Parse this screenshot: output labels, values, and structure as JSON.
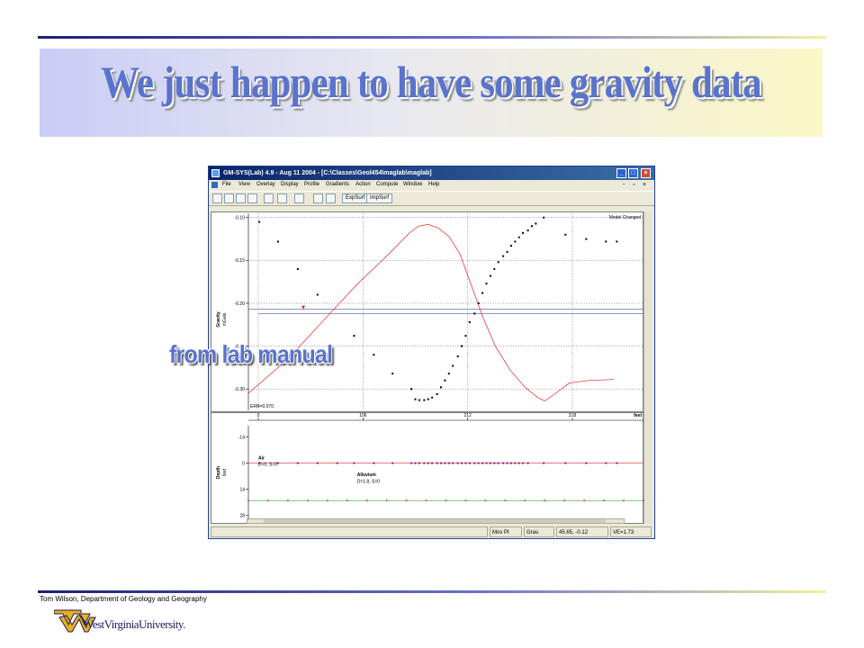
{
  "slide": {
    "title": "We just happen to have some gravity data",
    "annotation": "from lab manual",
    "author": "Tom Wilson, Department of Geology and Geography",
    "university": "WestVirginiaUniversity."
  },
  "colors": {
    "title": "#5a73cc",
    "rule_dark": "#1a1f7a",
    "rule_light": "#f3f0a0",
    "calc_curve": "#e02020",
    "observed_points": "#000000",
    "regional_line": "#6070c0",
    "air_line": "#e05050",
    "alluvium_line": "#30a030"
  },
  "window": {
    "title": "GM-SYS(Lab) 4.9 - Aug 11 2004 - [C:\\Classes\\Geol454\\maglab\\maglab]",
    "menu": [
      "File",
      "View",
      "Overlay",
      "Display",
      "Profile",
      "Gradients",
      "Action",
      "Compute",
      "Window",
      "Help"
    ],
    "toolbar_buttons": [
      "ExpSurf",
      "ImpSurf"
    ],
    "controls": {
      "minimize": "_",
      "maximize": "□",
      "close": "×",
      "menu_min": "-",
      "menu_max": "▫",
      "menu_close": "×"
    },
    "status": {
      "mode": "Mov Pt",
      "field": "Grav.",
      "coords": "45.65, -0.12",
      "ve": "VE=1.73"
    }
  },
  "chart_data": [
    {
      "type": "scatter",
      "title": "",
      "ylabel": "Gravity\nmGals",
      "xlabel": "",
      "xlim": [
        -10,
        390
      ],
      "ylim": [
        -0.325,
        -0.095
      ],
      "y_ticks": [
        -0.1,
        -0.15,
        -0.2,
        -0.25,
        -0.3
      ],
      "y_tick_labels": [
        "-0.10",
        "-0.15",
        "-0.20",
        "-0.25",
        "-0.30"
      ],
      "x_ticks": [
        0,
        106,
        212,
        318
      ],
      "corner_label": "Model Changed",
      "error_label": "ERR=0.070",
      "observed": {
        "x": [
          1,
          20,
          40,
          60,
          97,
          117,
          136,
          155,
          159,
          163,
          168,
          172,
          176,
          181,
          185,
          189,
          193,
          197,
          202,
          206,
          210,
          214,
          219,
          223,
          227,
          231,
          235,
          239,
          243,
          248,
          252,
          256,
          260,
          264,
          268,
          273,
          277,
          281,
          289,
          311,
          332,
          352,
          363
        ],
        "y": [
          -0.105,
          -0.128,
          -0.16,
          -0.19,
          -0.238,
          -0.26,
          -0.282,
          -0.3,
          -0.312,
          -0.313,
          -0.313,
          -0.312,
          -0.31,
          -0.306,
          -0.298,
          -0.29,
          -0.282,
          -0.273,
          -0.262,
          -0.25,
          -0.238,
          -0.222,
          -0.212,
          -0.2,
          -0.188,
          -0.177,
          -0.168,
          -0.16,
          -0.152,
          -0.145,
          -0.14,
          -0.133,
          -0.128,
          -0.123,
          -0.118,
          -0.115,
          -0.11,
          -0.107,
          -0.1,
          -0.12,
          -0.125,
          -0.128,
          -0.128
        ]
      },
      "calculated": {
        "x": [
          -10,
          30,
          70,
          100,
          130,
          153,
          162,
          172,
          182,
          193,
          204,
          216,
          228,
          240,
          255,
          270,
          283,
          290,
          300,
          315,
          335,
          360
        ],
        "y": [
          -0.305,
          -0.265,
          -0.215,
          -0.178,
          -0.145,
          -0.118,
          -0.11,
          -0.108,
          -0.112,
          -0.122,
          -0.142,
          -0.18,
          -0.218,
          -0.25,
          -0.278,
          -0.298,
          -0.31,
          -0.314,
          -0.306,
          -0.293,
          -0.29,
          -0.289
        ]
      },
      "regional": {
        "x": [
          0,
          390
        ],
        "y": [
          -0.212,
          -0.212
        ]
      },
      "upper_line": {
        "x": [
          -10,
          390
        ],
        "y": [
          -0.207,
          -0.207
        ]
      },
      "grid": true
    },
    {
      "type": "scatter",
      "title": "",
      "ylabel": "Depth\nfeet",
      "xlabel": "feet",
      "xlim": [
        -10,
        390
      ],
      "ylim": [
        -20,
        30
      ],
      "y_ticks": [
        -14,
        0,
        14,
        28
      ],
      "y_tick_labels": [
        "-14",
        "0",
        "14",
        "28"
      ],
      "layers": [
        {
          "name": "Air",
          "params": "D=0, S=0"
        },
        {
          "name": "Alluvium",
          "params": "D=1.8, S=0"
        }
      ],
      "surface": {
        "y": 0,
        "x": [
          1,
          20,
          40,
          60,
          80,
          97,
          117,
          136,
          155,
          159,
          163,
          168,
          172,
          176,
          181,
          185,
          189,
          193,
          197,
          202,
          206,
          210,
          214,
          219,
          223,
          227,
          231,
          235,
          239,
          243,
          248,
          252,
          256,
          260,
          264,
          268,
          273,
          289,
          311,
          332,
          352,
          363
        ]
      },
      "base": {
        "y": 20,
        "x": [
          -10,
          10,
          30,
          50,
          70,
          90,
          110,
          130,
          150,
          170,
          190,
          210,
          230,
          250,
          270,
          290,
          310,
          330,
          350,
          370,
          390
        ]
      },
      "grid": false
    }
  ]
}
